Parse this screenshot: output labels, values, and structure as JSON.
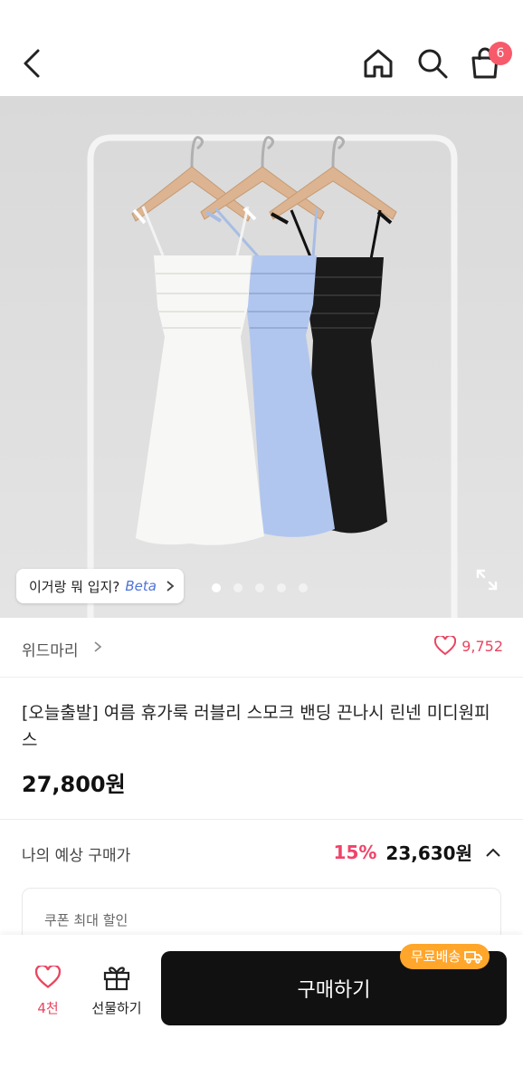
{
  "header": {
    "cart_count": "6"
  },
  "hero": {
    "ai_prompt_label": "이거랑 뭐 입지?",
    "ai_beta_label": "Beta",
    "slide_count": 5,
    "active_slide": 1
  },
  "brand": {
    "name": "위드마리",
    "like_count": "9,752"
  },
  "product": {
    "title": "[오늘출발] 여름 휴가룩 러블리 스모크 밴딩 끈나시 린넨 미디원피스",
    "price": "27,800원"
  },
  "estimate": {
    "label": "나의 예상 구매가",
    "discount": "15%",
    "price": "23,630원"
  },
  "coupon": {
    "label": "쿠폰 최대 할인"
  },
  "bottom": {
    "wish_count": "4천",
    "gift_label": "선물하기",
    "buy_label": "구매하기",
    "shipping_badge": "무료배송"
  },
  "colors": {
    "accent_pink": "#e94560",
    "badge_red": "#f65a6b",
    "buy_button": "#111111",
    "shipping_orange": "#ffa62b"
  }
}
